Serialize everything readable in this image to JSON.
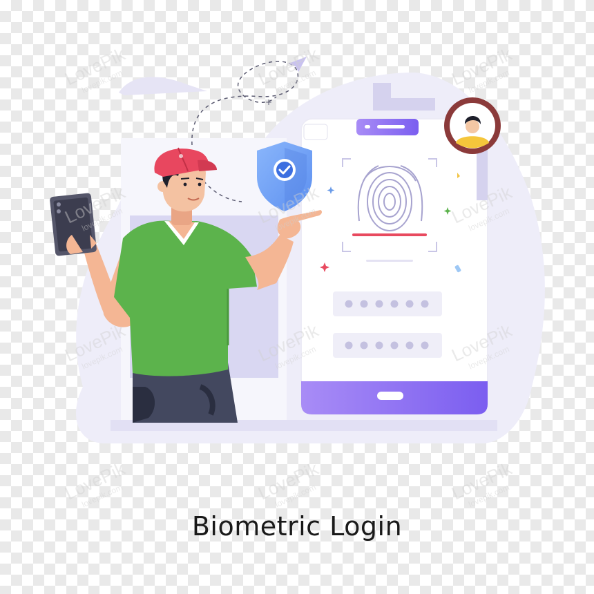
{
  "caption": "Biometric Login",
  "colors": {
    "blob": "#eeedf9",
    "phone_accent": "#8b6cf0",
    "shirt": "#5cb34c",
    "cap": "#e8475f",
    "shield": "#6f9ff5",
    "scan_line": "#e84a5f",
    "avatar_ring": "#8b3a3a"
  },
  "icons": [
    "fingerprint-icon",
    "shield-check-icon",
    "user-avatar-icon",
    "smartphone-icon"
  ],
  "watermark": {
    "brand": "LovePik",
    "site": "lovepik.com"
  }
}
